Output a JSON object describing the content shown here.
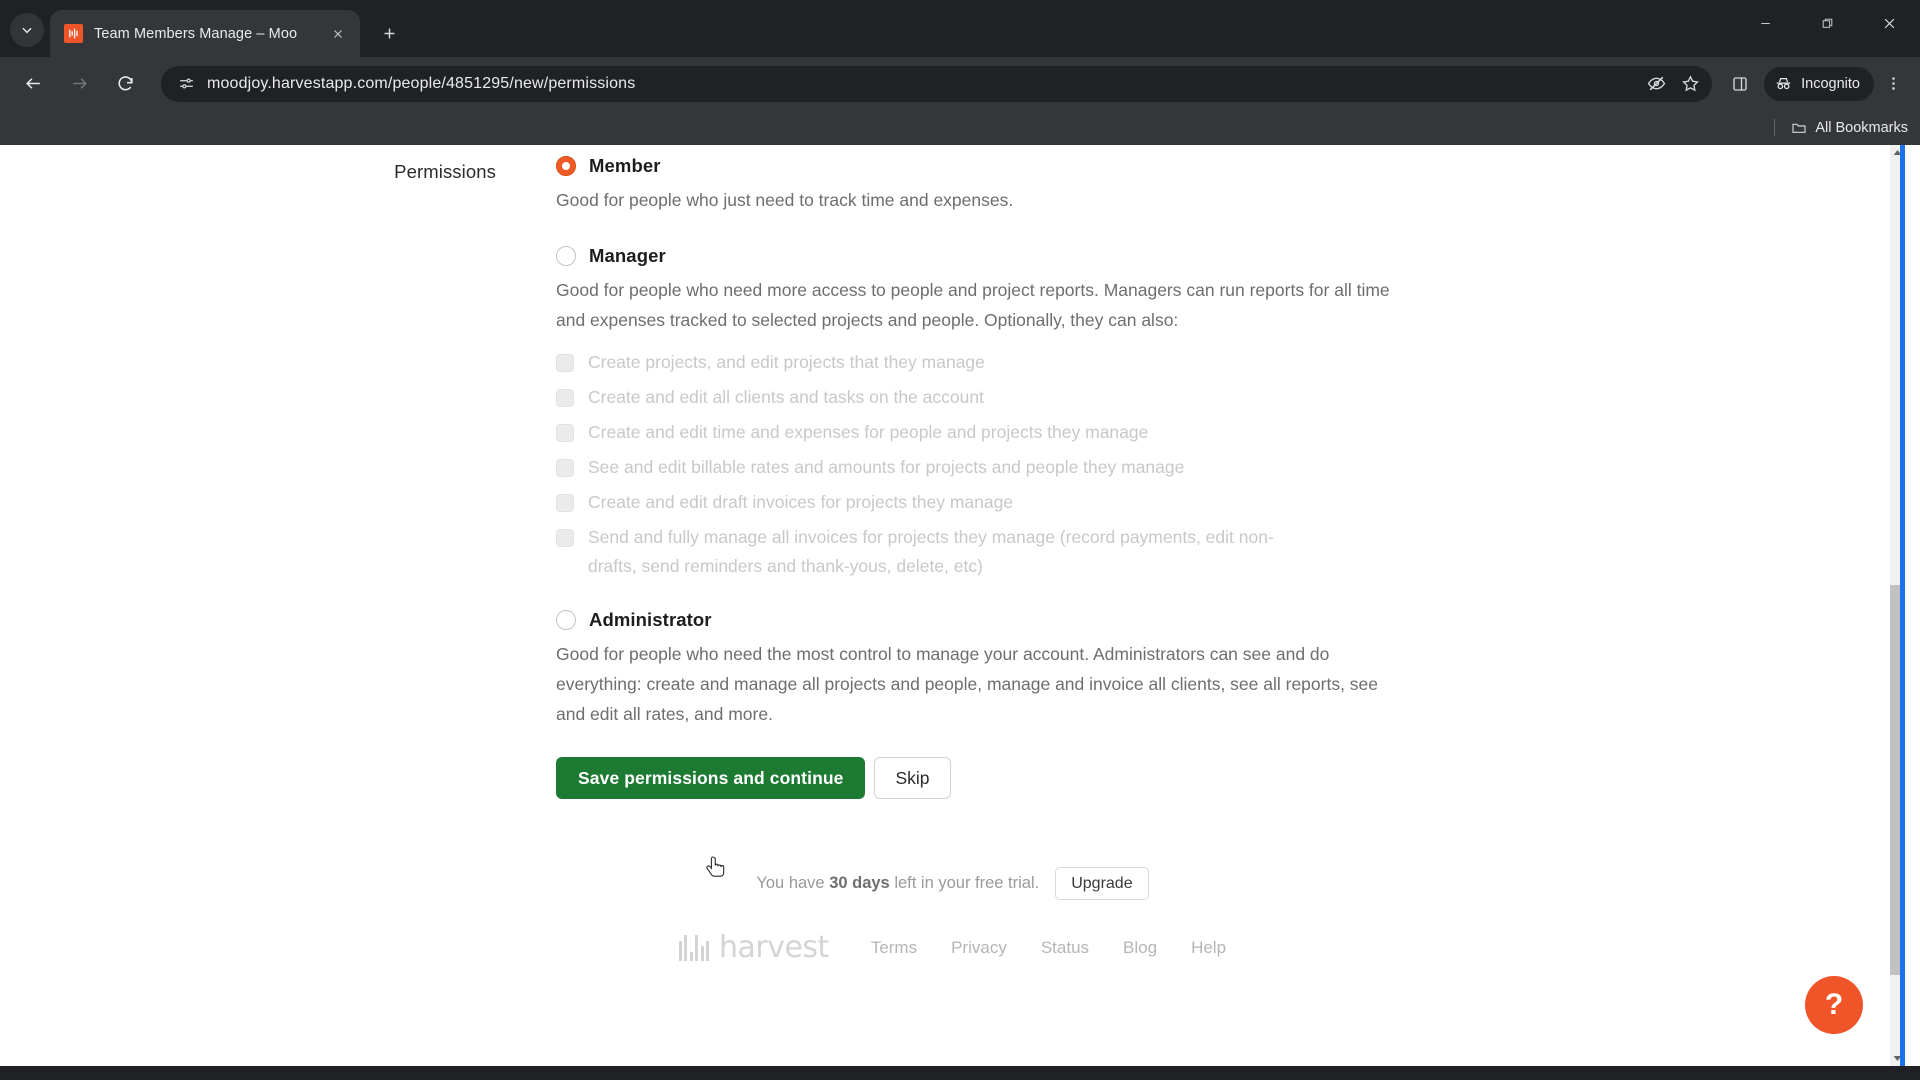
{
  "browser": {
    "tab": {
      "title": "Team Members Manage – Moo",
      "favicon": "harvest-favicon"
    },
    "new_tab_label": "+",
    "url": "moodjoy.harvestapp.com/people/4851295/new/permissions",
    "incognito_label": "Incognito",
    "bookmarks": {
      "all_bookmarks_label": "All Bookmarks"
    },
    "window_controls": {
      "minimize": "minimize",
      "maximize": "restore",
      "close": "close"
    }
  },
  "form": {
    "section_label": "Permissions",
    "options": [
      {
        "id": "member",
        "title": "Member",
        "selected": true,
        "description": "Good for people who just need to track time and expenses."
      },
      {
        "id": "manager",
        "title": "Manager",
        "selected": false,
        "description": "Good for people who need more access to people and project reports. Managers can run reports for all time and expenses tracked to selected projects and people. Optionally, they can also:",
        "checkboxes": [
          {
            "label": "Create projects, and edit projects that they manage",
            "checked": false,
            "disabled": true
          },
          {
            "label": "Create and edit all clients and tasks on the account",
            "checked": false,
            "disabled": true
          },
          {
            "label": "Create and edit time and expenses for people and projects they manage",
            "checked": false,
            "disabled": true
          },
          {
            "label": "See and edit billable rates and amounts for projects and people they manage",
            "checked": false,
            "disabled": true
          },
          {
            "label": "Create and edit draft invoices for projects they manage",
            "checked": false,
            "disabled": true
          },
          {
            "label": "Send and fully manage all invoices for projects they manage (record payments, edit non-drafts, send reminders and thank-yous, delete, etc)",
            "checked": false,
            "disabled": true
          }
        ]
      },
      {
        "id": "administrator",
        "title": "Administrator",
        "selected": false,
        "description": "Good for people who need the most control to manage your account. Administrators can see and do everything: create and manage all projects and people, manage and invoice all clients, see all reports, see and edit all rates, and more."
      }
    ],
    "save_label": "Save permissions and continue",
    "skip_label": "Skip"
  },
  "trial": {
    "prefix": "You have ",
    "days": "30 days",
    "suffix": " left in your free trial.",
    "upgrade_label": "Upgrade"
  },
  "footer": {
    "brand": "harvest",
    "links": [
      "Terms",
      "Privacy",
      "Status",
      "Blog",
      "Help"
    ]
  },
  "help_fab": {
    "glyph": "?"
  },
  "colors": {
    "accent_orange": "#f0552a",
    "radio_selected": "#f05a28",
    "save_green": "#1d7a32",
    "chrome_dark": "#202124",
    "chrome_toolbar": "#35363a"
  }
}
